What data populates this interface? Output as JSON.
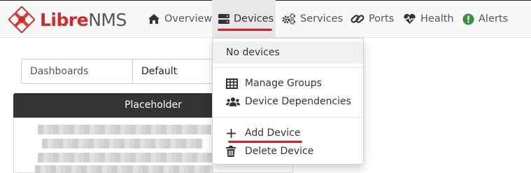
{
  "brand": {
    "libre": "Libre",
    "nms": "NMS",
    "colors": {
      "red": "#d32929",
      "gray": "#555555"
    }
  },
  "nav": {
    "items": [
      {
        "label": "Overview",
        "icon": "home-icon"
      },
      {
        "label": "Devices",
        "icon": "server-icon"
      },
      {
        "label": "Services",
        "icon": "cogs-icon"
      },
      {
        "label": "Ports",
        "icon": "link-icon"
      },
      {
        "label": "Health",
        "icon": "heartbeat-icon"
      },
      {
        "label": "Alerts",
        "icon": "exclamation-circle-icon"
      }
    ]
  },
  "dashboard": {
    "label": "Dashboards",
    "selected": "Default"
  },
  "widget": {
    "title": "Placeholder"
  },
  "devices_menu": {
    "no_devices": "No devices",
    "manage_groups": "Manage Groups",
    "device_dependencies": "Device Dependencies",
    "add_device": "Add Device",
    "delete_device": "Delete Device"
  },
  "accent_colors": {
    "highlight_underline": "#e8141e",
    "alert_green": "#3c8d3c"
  }
}
